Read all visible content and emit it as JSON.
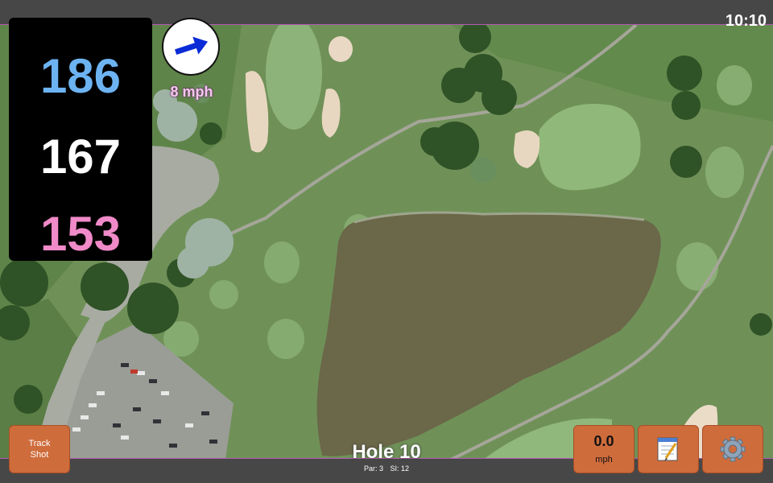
{
  "status_bar": {
    "time": "10:10"
  },
  "distances": {
    "back": {
      "value": "186",
      "color": "#6db3f2"
    },
    "middle": {
      "value": "167",
      "color": "#ffffff"
    },
    "front": {
      "value": "153",
      "color": "#f08ac8"
    }
  },
  "wind": {
    "speed": "8 mph",
    "arrow_color": "#0a2bd6",
    "icon": "wind-arrow-icon"
  },
  "buttons": {
    "track_shot": "Track\nShot",
    "speed_value": "0.0",
    "speed_unit": "mph",
    "notes_icon": "notepad-icon",
    "settings_icon": "gear-icon"
  },
  "hole": {
    "title": "Hole 10",
    "par": "Par: 3",
    "si": "SI: 12"
  },
  "colors": {
    "button": "#cf6c3c",
    "frame": "#474747"
  }
}
